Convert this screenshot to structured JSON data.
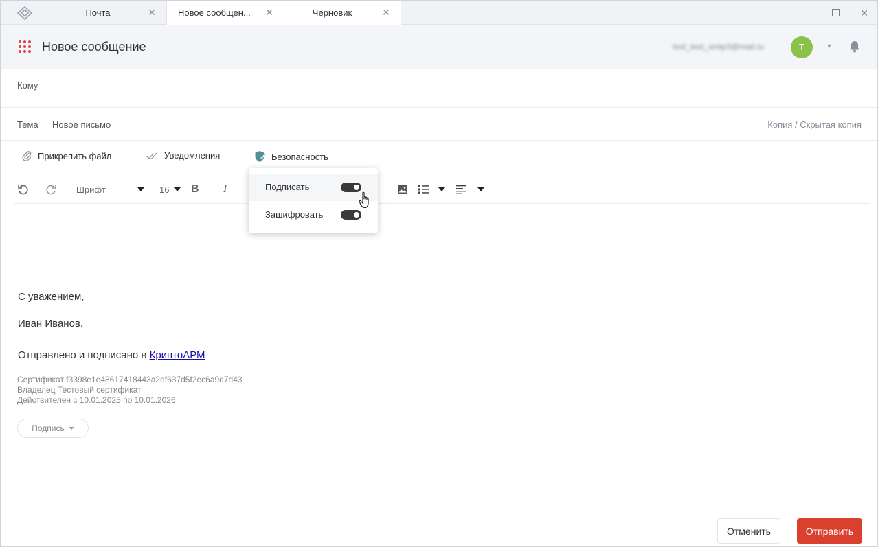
{
  "tabs": [
    {
      "label": "Почта"
    },
    {
      "label": "Новое сообщен..."
    },
    {
      "label": "Черновик"
    }
  ],
  "header": {
    "title": "Новое сообщение",
    "account_email": "test_test_smtp3@mail.ru",
    "avatar_letter": "Т"
  },
  "fields": {
    "to_label": "Кому",
    "subject_label": "Тема",
    "subject_value": "Новое письмо",
    "cc_link": "Копия / Скрытая копия"
  },
  "actions": {
    "attach": "Прикрепить файл",
    "notifications": "Уведомления",
    "security": "Безопасность"
  },
  "toolbar": {
    "font": "Шрифт",
    "size": "16"
  },
  "security_menu": {
    "sign": {
      "label": "Подписать",
      "enabled": true
    },
    "encrypt": {
      "label": "Зашифровать",
      "enabled": true
    }
  },
  "body": {
    "greeting": "С уважением,",
    "name": "Иван Иванов.",
    "sent_prefix": "Отправлено и подписано в ",
    "sent_link": "КриптоАРМ",
    "cert_line1": "Сертификат f3398e1e48617418443a2df637d5f2ec6a9d7d43",
    "cert_line2": "Владелец Тестовый сертификат",
    "cert_line3": "Действителен с 10.01.2025 по 10.01.2026",
    "signature_button": "Подпись"
  },
  "footer": {
    "cancel": "Отменить",
    "send": "Отправить"
  },
  "colors": {
    "send_button": "#d9412e",
    "avatar": "#8bc34a",
    "apps_icon": "#e04545",
    "shield": "#4f8f96"
  }
}
